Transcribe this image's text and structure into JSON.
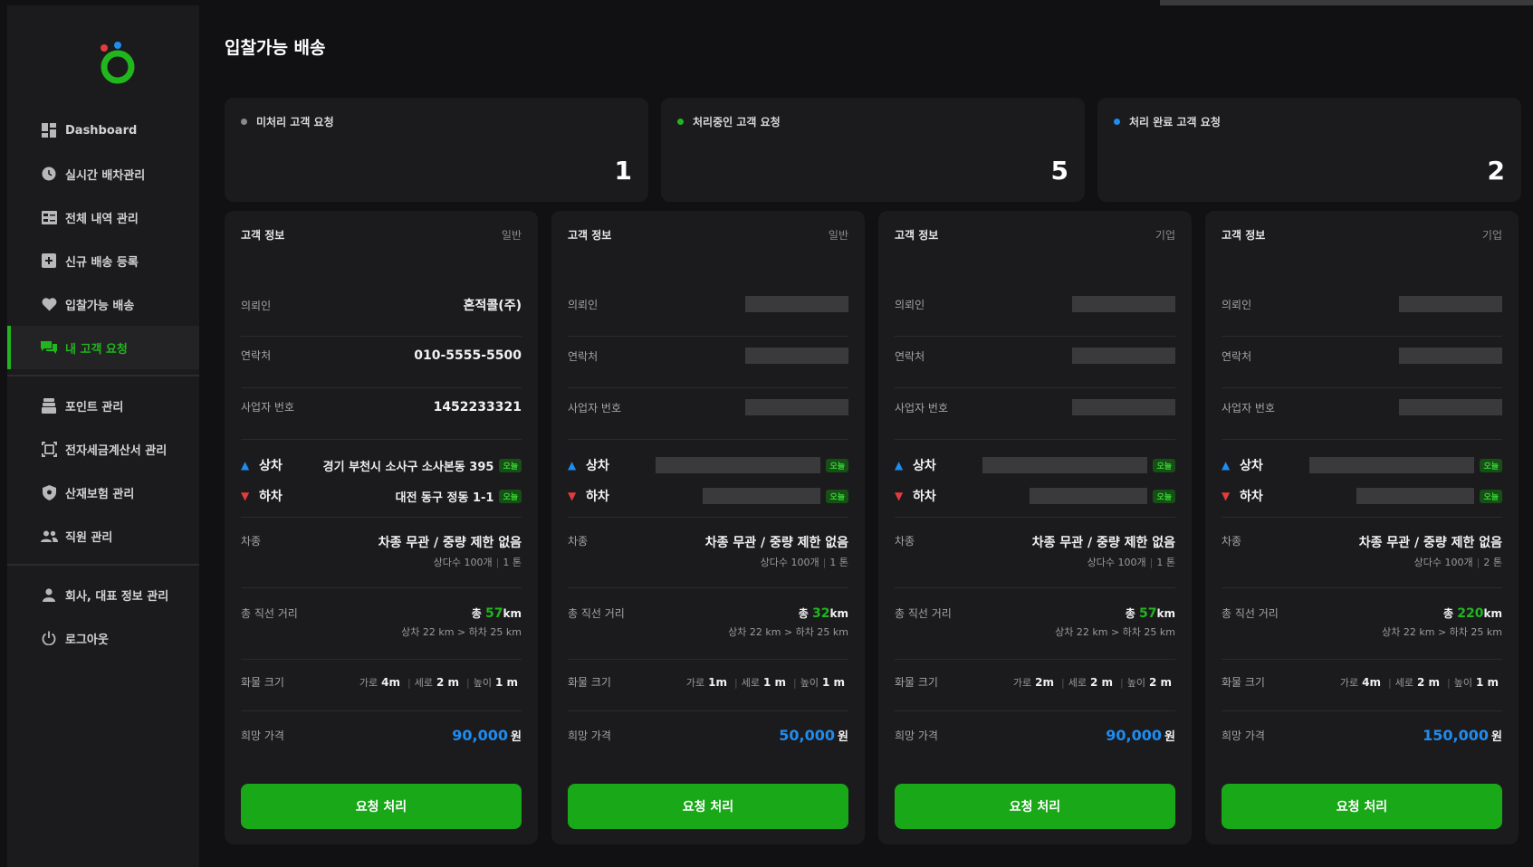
{
  "page": {
    "title": "입찰가능 배송"
  },
  "sidebar": {
    "items": [
      {
        "label": "Dashboard",
        "icon": "dashboard-icon"
      },
      {
        "label": "실시간 배차관리",
        "icon": "clock-icon"
      },
      {
        "label": "전체 내역 관리",
        "icon": "list-icon"
      },
      {
        "label": "신규 배송 등록",
        "icon": "plus-square-icon"
      },
      {
        "label": "입찰가능 배송",
        "icon": "heart-icon"
      },
      {
        "label": "내 고객 요청",
        "icon": "chat-icon",
        "active": true
      },
      {
        "label": "포인트 관리",
        "icon": "coin-stack-icon"
      },
      {
        "label": "전자세금계산서 관리",
        "icon": "receipt-icon"
      },
      {
        "label": "산재보험 관리",
        "icon": "shield-icon"
      },
      {
        "label": "직원 관리",
        "icon": "people-icon"
      },
      {
        "label": "회사, 대표 정보 관리",
        "icon": "person-icon"
      },
      {
        "label": "로그아웃",
        "icon": "power-icon"
      }
    ]
  },
  "stats": [
    {
      "label": "미처리 고객 요청",
      "value": "1",
      "dot_color": "#8a8a8a"
    },
    {
      "label": "처리중인 고객 요청",
      "value": "5",
      "dot_color": "#21b51e"
    },
    {
      "label": "처리 완료 고객 요청",
      "value": "2",
      "dot_color": "#1e8cf0"
    }
  ],
  "labels": {
    "card_title": "고객 정보",
    "requester": "의뢰인",
    "contact": "연락처",
    "biz_no": "사업자 번호",
    "pickup": "상차",
    "dropoff": "하차",
    "today": "오늘",
    "vehicle": "차종",
    "distance": "총 직선 거리",
    "cargo_size": "화물 크기",
    "price": "희망 가격",
    "total": "총",
    "km": "km",
    "width": "가로",
    "length": "세로",
    "height": "높이",
    "won": "원",
    "button": "요청 처리"
  },
  "cards": [
    {
      "type": "일반",
      "requester": "혼적콜(주)",
      "contact": "010-5555-5500",
      "biz_no": "1452233321",
      "pickup": "경기 부천시 소사구 소사본동 395",
      "dropoff": "대전 동구 정동 1-1",
      "vehicle": "차종 무관 / 중량 제한 없음",
      "vehicle_sub1": "상다수 100개",
      "vehicle_sub2": "1 톤",
      "distance": "57",
      "distance_sub": "상차 22 km > 하차 25 km",
      "size_w": "4m",
      "size_l": "2 m",
      "size_h": "1 m",
      "price": "90,000"
    },
    {
      "type": "일반",
      "vehicle": "차종 무관 / 중량 제한 없음",
      "vehicle_sub1": "상다수 100개",
      "vehicle_sub2": "1 톤",
      "distance": "32",
      "distance_sub": "상차 22 km > 하차 25 km",
      "size_w": "1m",
      "size_l": "1 m",
      "size_h": "1 m",
      "price": "50,000"
    },
    {
      "type": "기업",
      "vehicle": "차종 무관 / 중량 제한 없음",
      "vehicle_sub1": "상다수 100개",
      "vehicle_sub2": "1 톤",
      "distance": "57",
      "distance_sub": "상차 22 km > 하차 25 km",
      "size_w": "2m",
      "size_l": "2 m",
      "size_h": "2 m",
      "price": "90,000"
    },
    {
      "type": "기업",
      "vehicle": "차종 무관 / 중량 제한 없음",
      "vehicle_sub1": "상다수 100개",
      "vehicle_sub2": "2 톤",
      "distance": "220",
      "distance_sub": "상차 22 km > 하차 25 km",
      "size_w": "4m",
      "size_l": "2 m",
      "size_h": "1 m",
      "price": "150,000"
    }
  ]
}
